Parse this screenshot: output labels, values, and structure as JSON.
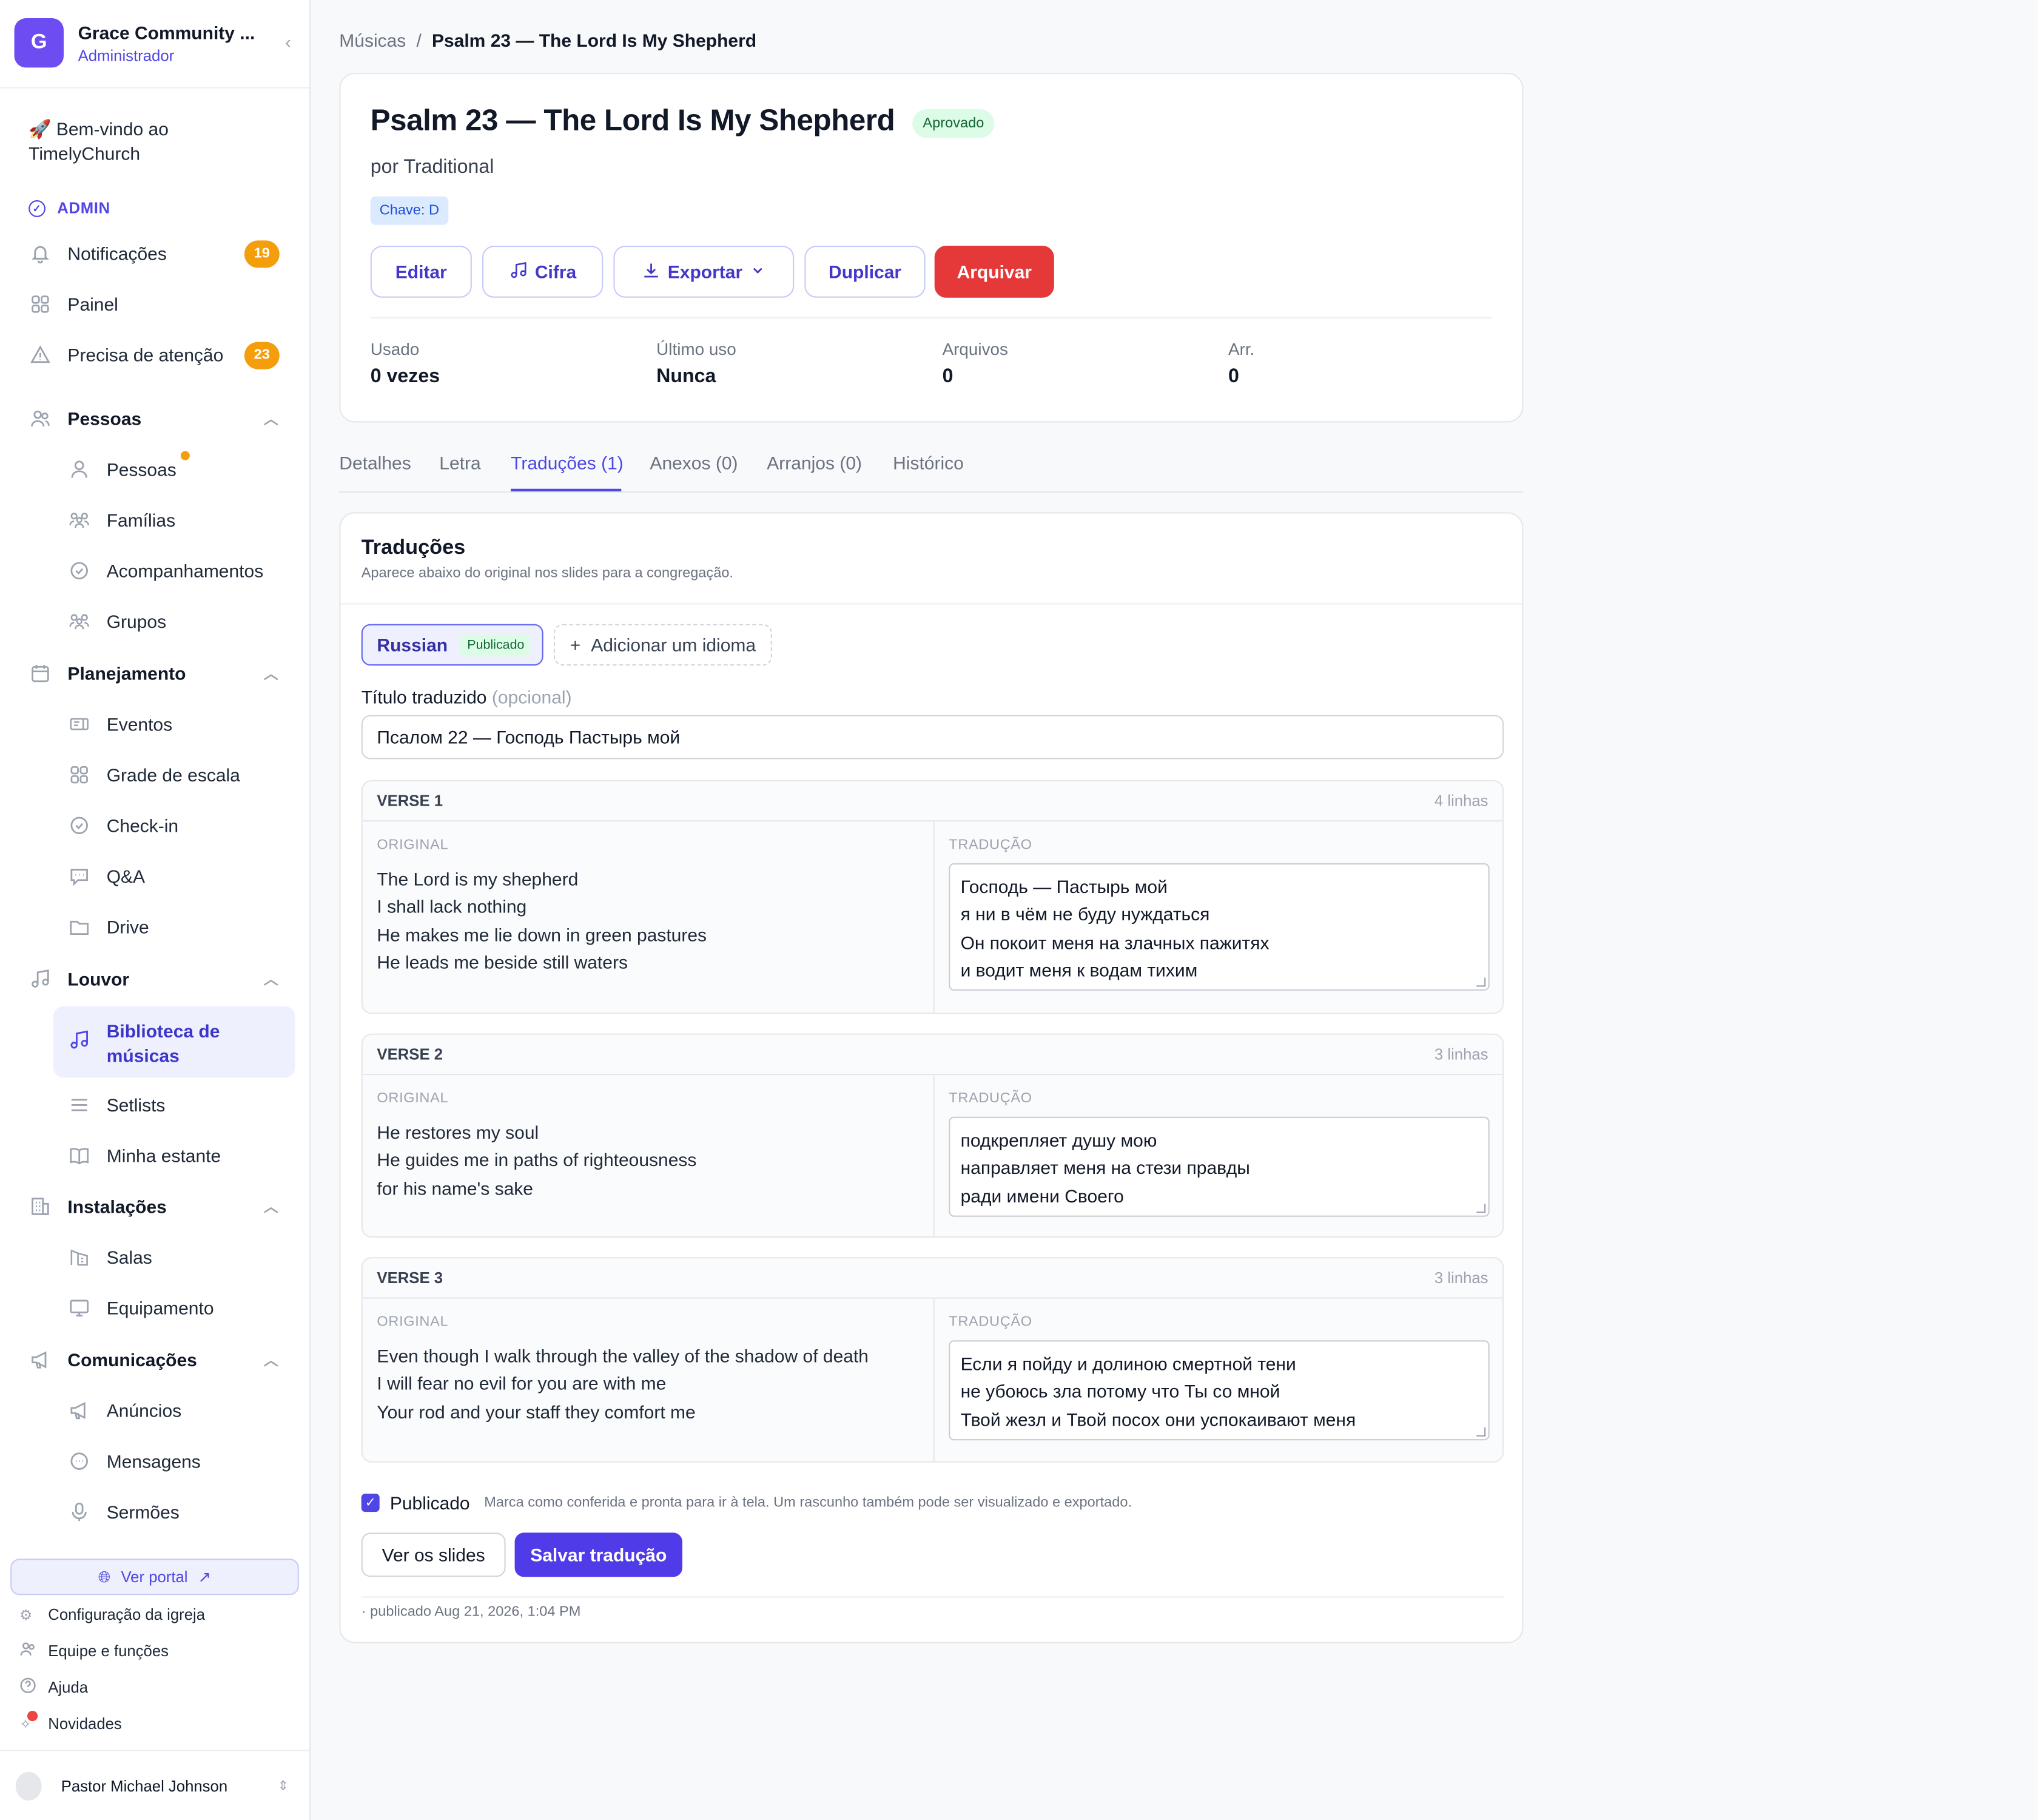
{
  "sidebar": {
    "org_initial": "G",
    "org_name": "Grace Community ...",
    "org_role": "Administrador",
    "welcome": "🚀 Bem-vindo ao TimelyChurch",
    "admin_label": "ADMIN",
    "notifications": {
      "label": "Notificações",
      "count": "19"
    },
    "panel": "Painel",
    "attention": {
      "label": "Precisa de atenção",
      "count": "23"
    },
    "people_group": "Pessoas",
    "people": [
      "Pessoas",
      "Famílias",
      "Acompanhamentos",
      "Grupos"
    ],
    "planning_group": "Planejamento",
    "planning": [
      "Eventos",
      "Grade de escala",
      "Check-in",
      "Q&A",
      "Drive"
    ],
    "worship_group": "Louvor",
    "worship_active": "Biblioteca de músicas",
    "worship": [
      "Setlists",
      "Minha estante"
    ],
    "facilities_group": "Instalações",
    "facilities": [
      "Salas",
      "Equipamento"
    ],
    "comms_group": "Comunicações",
    "comms": [
      "Anúncios",
      "Mensagens",
      "Sermões"
    ],
    "portal_button": "Ver portal",
    "footer": [
      "Configuração da igreja",
      "Equipe e funções",
      "Ajuda",
      "Novidades"
    ],
    "user_name": "Pastor Michael Johnson"
  },
  "breadcrumb": {
    "parent": "Músicas",
    "separator": "/",
    "current": "Psalm 23 — The Lord Is My Shepherd"
  },
  "song": {
    "title": "Psalm 23 — The Lord Is My Shepherd",
    "status": "Aprovado",
    "author": "por Traditional",
    "key": "Chave: D"
  },
  "actions": {
    "edit": "Editar",
    "chords": "Cifra",
    "export": "Exportar",
    "duplicate": "Duplicar",
    "archive": "Arquivar"
  },
  "stats": [
    {
      "label": "Usado",
      "value": "0 vezes"
    },
    {
      "label": "Último uso",
      "value": "Nunca"
    },
    {
      "label": "Arquivos",
      "value": "0"
    },
    {
      "label": "Arr.",
      "value": "0"
    }
  ],
  "tabs": [
    "Detalhes",
    "Letra",
    "Traduções (1)",
    "Anexos (0)",
    "Arranjos (0)",
    "Histórico"
  ],
  "translations": {
    "title": "Traduções",
    "subtitle": "Aparece abaixo do original nos slides para a congregação.",
    "language": "Russian",
    "language_status": "Publicado",
    "add_language": "Adicionar um idioma",
    "title_label": "Título traduzido",
    "title_optional": "(opcional)",
    "translated_title": "Псалом 22 — Господь Пастырь мой",
    "original_label": "ORIGINAL",
    "translation_label": "TRADUÇÃO",
    "verses": [
      {
        "name": "VERSE 1",
        "count": "4 linhas",
        "original": [
          "The Lord is my shepherd",
          "I shall lack nothing",
          "He makes me lie down in green pastures",
          "He leads me beside still waters"
        ],
        "translation": [
          "Господь — Пастырь мой",
          "я ни в чём не буду нуждаться",
          "Он покоит меня на злачных пажитях",
          "и водит меня к водам тихим"
        ]
      },
      {
        "name": "VERSE 2",
        "count": "3 linhas",
        "original": [
          "He restores my soul",
          "He guides me in paths of righteousness",
          "for his name's sake"
        ],
        "translation": [
          "подкрепляет душу мою",
          "направляет меня на стези правды",
          "ради имени Своего"
        ]
      },
      {
        "name": "VERSE 3",
        "count": "3 linhas",
        "original": [
          "Even though I walk through the valley of the shadow of death",
          "I will fear no evil for you are with me",
          "Your rod and your staff they comfort me"
        ],
        "translation": [
          "Если я пойду и долиною смертной тени",
          "не убоюсь зла потому что Ты со мной",
          "Твой жезл и Твой посох они успокаивают меня"
        ]
      }
    ],
    "published_label": "Publicado",
    "published_help": "Marca como conferida e pronta para ir à tela. Um rascunho também pode ser visualizado e exportado.",
    "view_slides": "Ver os slides",
    "save": "Salvar tradução",
    "published_at": "· publicado Aug 21, 2026, 1:04 PM"
  }
}
